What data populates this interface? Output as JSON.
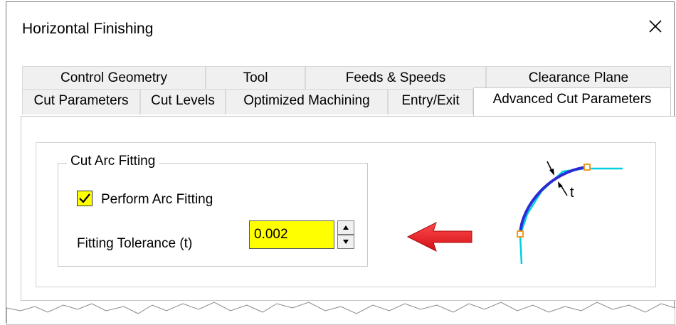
{
  "window": {
    "title": "Horizontal Finishing",
    "close_icon": "close-icon"
  },
  "tabs": {
    "row1": [
      "Control Geometry",
      "Tool",
      "Feeds & Speeds",
      "Clearance Plane"
    ],
    "row2": [
      "Cut Parameters",
      "Cut Levels",
      "Optimized Machining",
      "Entry/Exit",
      "Advanced Cut Parameters"
    ],
    "active": "Advanced Cut Parameters"
  },
  "cut_arc_fitting": {
    "group_title": "Cut Arc Fitting",
    "perform_arc_fitting_label": "Perform Arc Fitting",
    "perform_arc_fitting_checked": true,
    "fitting_tolerance_label": "Fitting Tolerance (t)",
    "fitting_tolerance_value": "0.002"
  },
  "diagram": {
    "label": "t"
  },
  "colors": {
    "highlight_yellow": "#ffff00",
    "arrow_red": "#e5161e",
    "curve_blue": "#2b2bd6",
    "curve_cyan": "#00cfe0",
    "point_orange": "#f39a1e"
  }
}
